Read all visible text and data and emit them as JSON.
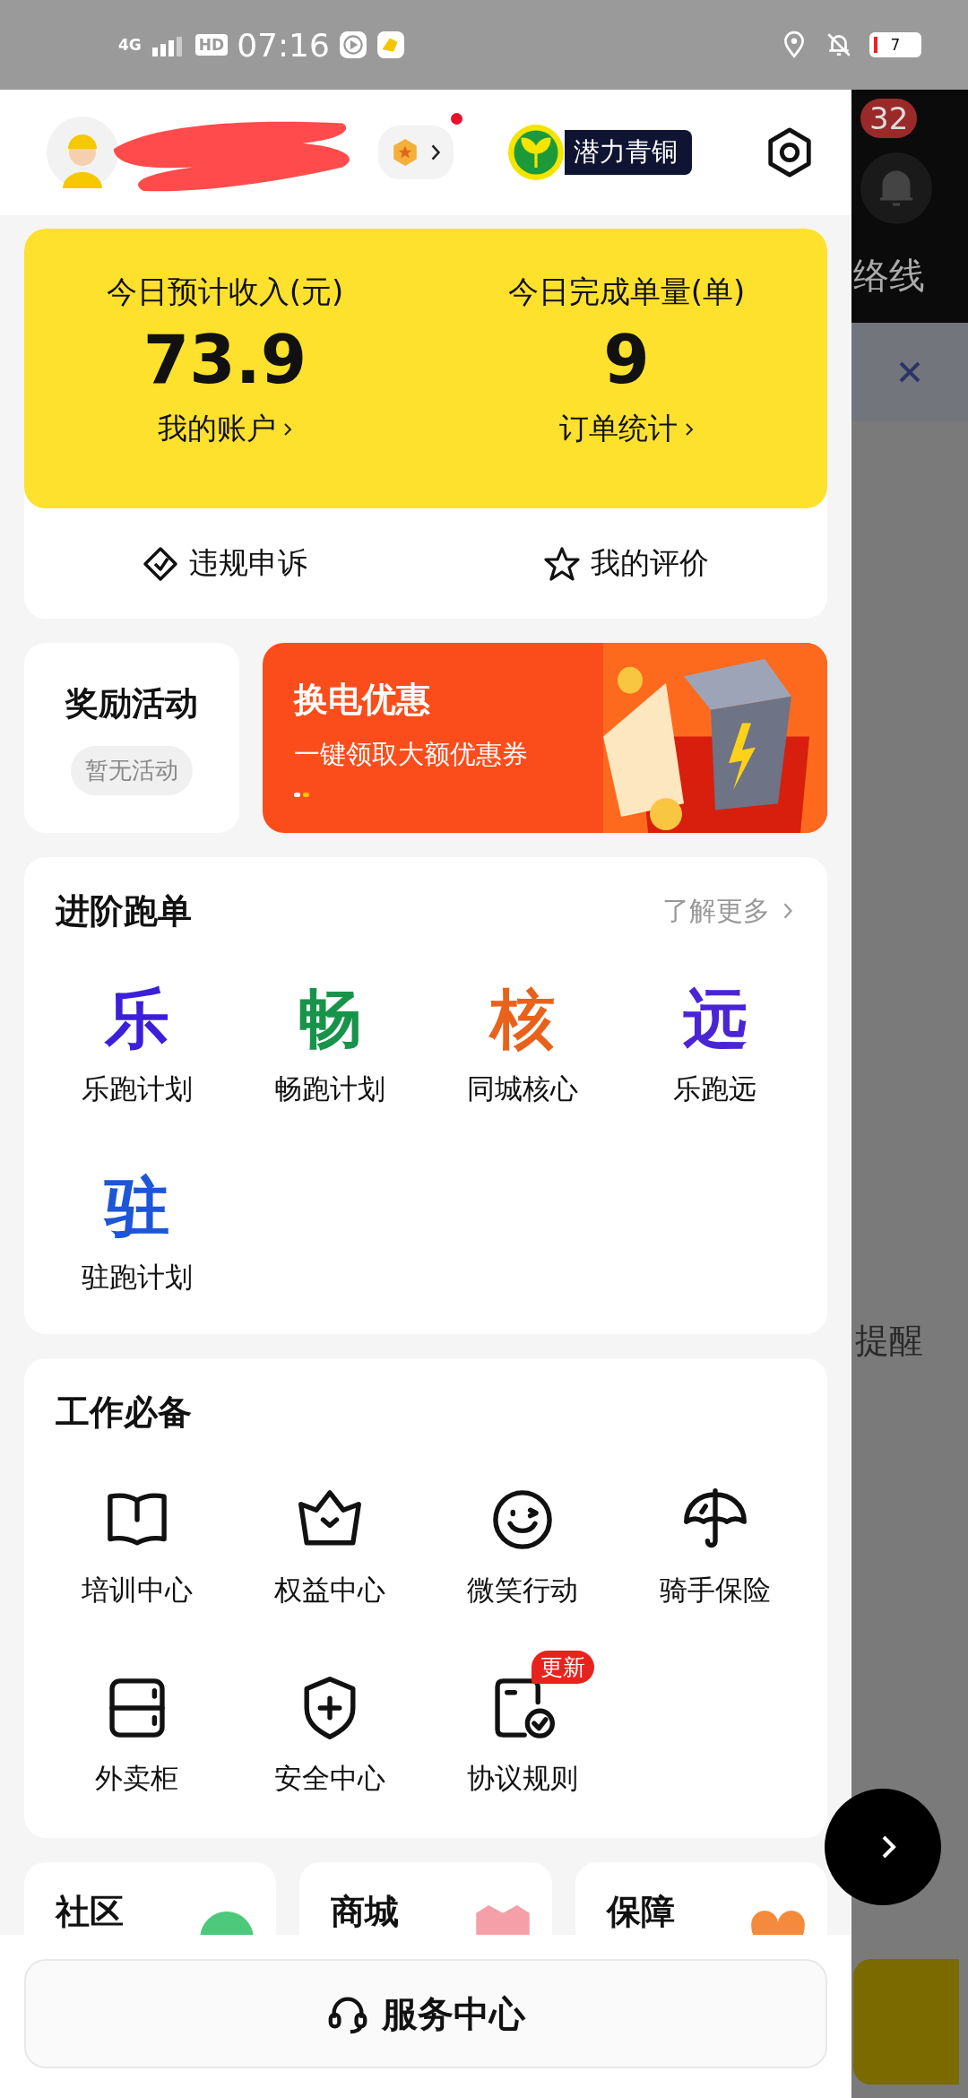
{
  "status_bar": {
    "network": "4G",
    "hd": "HD",
    "time": "07:16",
    "battery": "7"
  },
  "header": {
    "level_name": "潜力青铜",
    "notification_dot": true
  },
  "stats": [
    {
      "label": "今日预计收入(元)",
      "value": "73.9",
      "link": "我的账户"
    },
    {
      "label": "今日完成单量(单)",
      "value": "9",
      "link": "订单统计"
    }
  ],
  "quick_actions": [
    {
      "label": "违规申诉",
      "kind": "appeal"
    },
    {
      "label": "我的评价",
      "kind": "rating"
    }
  ],
  "rewards": {
    "title": "奖励活动",
    "status": "暂无活动"
  },
  "banner": {
    "title": "换电优惠",
    "subtitle": "一键领取大额优惠券"
  },
  "advanced": {
    "title": "进阶跑单",
    "more": "了解更多",
    "items": [
      {
        "glyph": "乐",
        "label": "乐跑计划",
        "color": "#3b1fd9"
      },
      {
        "glyph": "畅",
        "label": "畅跑计划",
        "color": "#17944a"
      },
      {
        "glyph": "核",
        "label": "同城核心",
        "color": "#e8621c"
      },
      {
        "glyph": "远",
        "label": "乐跑远",
        "color": "#4a25d4"
      },
      {
        "glyph": "驻",
        "label": "驻跑计划",
        "color": "#1d56d6"
      }
    ]
  },
  "essentials": {
    "title": "工作必备",
    "items": [
      {
        "label": "培训中心",
        "kind": "book"
      },
      {
        "label": "权益中心",
        "kind": "crown"
      },
      {
        "label": "微笑行动",
        "kind": "smile"
      },
      {
        "label": "骑手保险",
        "kind": "umbrella"
      },
      {
        "label": "外卖柜",
        "kind": "locker"
      },
      {
        "label": "安全中心",
        "kind": "shield"
      },
      {
        "label": "协议规则",
        "kind": "document",
        "badge": "更新"
      }
    ]
  },
  "bottom_cards": [
    {
      "title": "社区",
      "kind": "chat"
    },
    {
      "title": "商城",
      "kind": "gift"
    },
    {
      "title": "保障",
      "kind": "heart"
    }
  ],
  "service": {
    "label": "服务中心"
  },
  "background": {
    "notification_count": "32",
    "text_1": "络线",
    "text_2": "提醒"
  }
}
